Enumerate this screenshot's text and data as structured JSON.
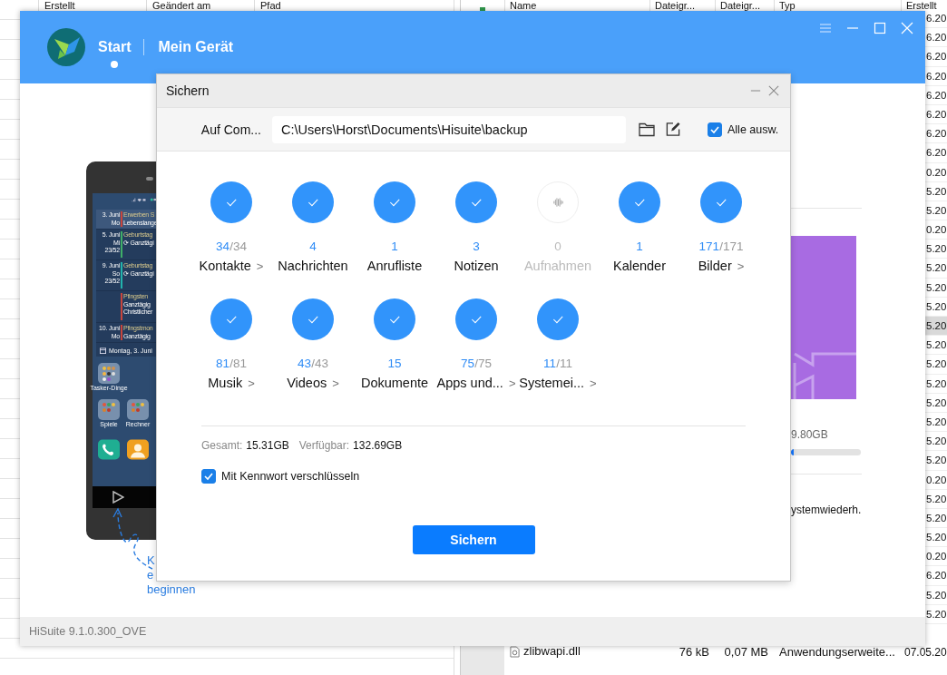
{
  "background": {
    "sheet": {
      "columns": [
        "Erstellt",
        "Geändert am",
        "Pfad"
      ]
    },
    "explorer": {
      "columns": [
        "Name",
        "Dateigr...",
        "Dateigr...",
        "Typ",
        "Erstellt"
      ],
      "dates": [
        {
          "text": "6.20",
          "selected": false
        },
        {
          "text": "6.20",
          "selected": false
        },
        {
          "text": "6.20",
          "selected": false
        },
        {
          "text": "6.20",
          "selected": false
        },
        {
          "text": "6.20",
          "selected": false
        },
        {
          "text": "6.20",
          "selected": false
        },
        {
          "text": "6.20",
          "selected": false
        },
        {
          "text": "6.20",
          "selected": false
        },
        {
          "text": "0.20",
          "selected": false
        },
        {
          "text": "5.20",
          "selected": false
        },
        {
          "text": "5.20",
          "selected": false
        },
        {
          "text": "0.20",
          "selected": false
        },
        {
          "text": "5.20",
          "selected": false
        },
        {
          "text": "5.20",
          "selected": false
        },
        {
          "text": "5.20",
          "selected": false
        },
        {
          "text": "5.20",
          "selected": false
        },
        {
          "text": "5.20",
          "selected": true
        },
        {
          "text": "5.20",
          "selected": false
        },
        {
          "text": "5.20",
          "selected": false
        },
        {
          "text": "5.20",
          "selected": false
        },
        {
          "text": "5.20",
          "selected": false
        },
        {
          "text": "5.20",
          "selected": false
        },
        {
          "text": "5.20",
          "selected": false
        },
        {
          "text": "5.20",
          "selected": false
        },
        {
          "text": "0.20",
          "selected": false
        },
        {
          "text": "5.20",
          "selected": false
        },
        {
          "text": "5.20",
          "selected": false
        },
        {
          "text": "5.20",
          "selected": false
        },
        {
          "text": "0.20",
          "selected": false
        },
        {
          "text": "6.20",
          "selected": false
        },
        {
          "text": "5.20",
          "selected": false
        },
        {
          "text": "5.20",
          "selected": false
        }
      ],
      "last_row": {
        "name": "zlibwapi.dll",
        "size_kb": "76 kB",
        "size_mb": "0,07 MB",
        "type": "Anwendungserweite...",
        "created": "07.05.20"
      }
    }
  },
  "app": {
    "tabs": [
      {
        "label": "Start",
        "selected": true
      },
      {
        "label": "Mein Gerät",
        "selected": false
      }
    ],
    "phone": {
      "events": [
        {
          "date": "3. Juni",
          "day": "Mo",
          "color": "#c9453c",
          "title": "Erwerben S",
          "lines": [
            "Lebenslange"
          ],
          "selected": true
        },
        {
          "date": "5. Juni",
          "day": "Mi",
          "week": "23/52",
          "color": "#3fae68",
          "title": "Geburtstag",
          "lines": [
            "⟳ Ganztägi"
          ],
          "selected": false
        },
        {
          "date": "9. Juni",
          "day": "So",
          "week": "23/52",
          "color": "#22b3ad",
          "title": "Geburtstag",
          "lines": [
            "⟳ Ganztägi"
          ],
          "selected": false
        },
        {
          "color": "#c9453c",
          "title": "Pfingsten",
          "lines": [
            "Ganztägig",
            "Christlicher"
          ],
          "selected": false
        },
        {
          "date": "10. Juni",
          "day": "Mo",
          "color": "#c9453c",
          "title": "Pfingstmon",
          "lines": [
            "Ganztägig"
          ],
          "selected": false
        }
      ],
      "calendar_footer": "Montag, 3. Juni",
      "folders": [
        "Tasker-Dinge",
        "Spiele",
        "Rechner"
      ]
    },
    "hint": [
      "K",
      "e",
      "beginnen"
    ],
    "storage": {
      "free": "9.80GB",
      "level": 0.04,
      "item": "ystemwiederh."
    },
    "version": "HiSuite 9.1.0.300_OVE"
  },
  "dialog": {
    "title": "Sichern",
    "path_label": "Auf Com...",
    "path": "C:\\Users\\Horst\\Documents\\Hisuite\\backup",
    "select_all": {
      "label": "Alle ausw.",
      "checked": true
    },
    "items": [
      {
        "count": "34",
        "total": "/34",
        "label": "Kontakte",
        "more": ">",
        "checked": true,
        "disabled": false
      },
      {
        "count": "4",
        "label": "Nachrichten",
        "checked": true,
        "disabled": false
      },
      {
        "count": "1",
        "label": "Anrufliste",
        "checked": true,
        "disabled": false
      },
      {
        "count": "3",
        "label": "Notizen",
        "checked": true,
        "disabled": false
      },
      {
        "count": "0",
        "label": "Aufnahmen",
        "checked": false,
        "disabled": true
      },
      {
        "count": "1",
        "label": "Kalender",
        "checked": true,
        "disabled": false
      },
      {
        "count": "171",
        "total": "/171",
        "label": "Bilder",
        "more": ">",
        "checked": true,
        "disabled": false
      },
      {
        "count": "81",
        "total": "/81",
        "label": "Musik",
        "more": ">",
        "checked": true,
        "disabled": false
      },
      {
        "count": "43",
        "total": "/43",
        "label": "Videos",
        "more": ">",
        "checked": true,
        "disabled": false
      },
      {
        "count": "15",
        "label": "Dokumente",
        "checked": true,
        "disabled": false
      },
      {
        "count": "75",
        "total": "/75",
        "label": "Apps und...",
        "more": ">",
        "checked": true,
        "disabled": false
      },
      {
        "count": "11",
        "total": "/11",
        "label": "Systemei...",
        "more": ">",
        "checked": true,
        "disabled": false
      }
    ],
    "total_label": "Gesamt:",
    "total": "15.31GB",
    "free_label": "Verfügbar:",
    "free": "132.69GB",
    "encrypt": {
      "label": "Mit Kennwort verschlüsseln",
      "checked": true
    },
    "button": "Sichern"
  }
}
